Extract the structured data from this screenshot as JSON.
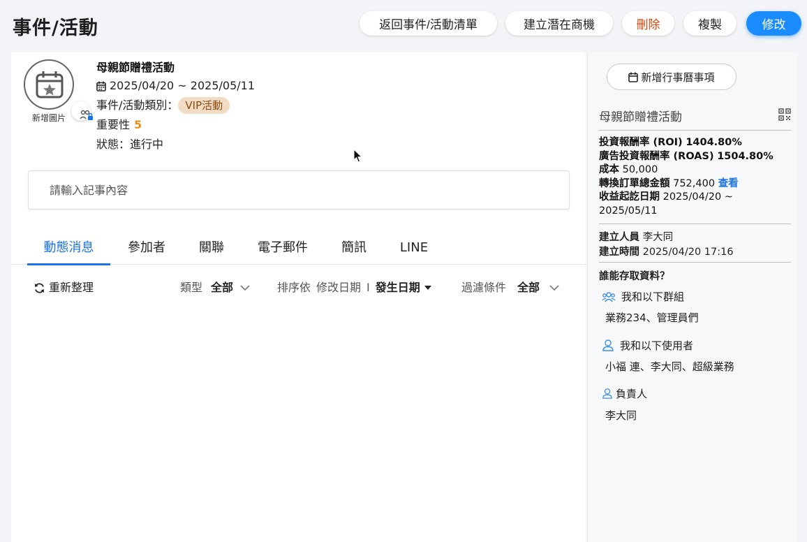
{
  "header": {
    "title": "事件/活動",
    "buttons": {
      "back": "返回事件/活動清單",
      "create_opportunity": "建立潛在商機",
      "delete": "刪除",
      "copy": "複製",
      "edit": "修改"
    }
  },
  "event": {
    "add_image_label": "新增圖片",
    "title": "母親節贈禮活動",
    "date_range": "2025/04/20 ~ 2025/05/11",
    "category_label": "事件/活動類別：",
    "category_value": "VIP活動",
    "importance_label": "重要性",
    "importance_value": "5",
    "status_label": "狀態：",
    "status_value": "進行中"
  },
  "note": {
    "placeholder": "請輸入記事內容"
  },
  "tabs": [
    {
      "label": "動態消息",
      "active": true
    },
    {
      "label": "參加者"
    },
    {
      "label": "關聯"
    },
    {
      "label": "電子郵件"
    },
    {
      "label": "簡訊"
    },
    {
      "label": "LINE"
    }
  ],
  "toolbar": {
    "refresh_label": "重新整理",
    "type_label": "類型",
    "type_value": "全部",
    "sort_label": "排序依",
    "sort_option1": "修改日期",
    "sort_separator": "I",
    "sort_option2": "發生日期",
    "filter_label": "過濾條件",
    "filter_value": "全部"
  },
  "sidebar": {
    "add_calendar_label": "新增行事曆事項",
    "title": "母親節贈禮活動",
    "roi_label": "投資報酬率 (ROI)",
    "roi_value": "1404.80%",
    "roas_label": "廣告投資報酬率 (ROAS)",
    "roas_value": "1504.80%",
    "cost_label": "成本",
    "cost_value": "50,000",
    "conversion_label": "轉換訂單總金額",
    "conversion_value": "752,400",
    "view_link": "查看",
    "revenue_label": "收益起訖日期",
    "revenue_value_start": "2025/04/20 ~",
    "revenue_value_end": "2025/05/11",
    "creator_label": "建立人員",
    "creator_value": "李大同",
    "created_label": "建立時間",
    "created_value": "2025/04/20 17:16",
    "access_title": "誰能存取資料？",
    "groups_label": "我和以下群組",
    "groups_value": "業務234、管理員們",
    "users_label": "我和以下使用者",
    "users_value": "小福 連、李大同、超級業務",
    "owner_label": "負責人",
    "owner_value": "李大同"
  }
}
